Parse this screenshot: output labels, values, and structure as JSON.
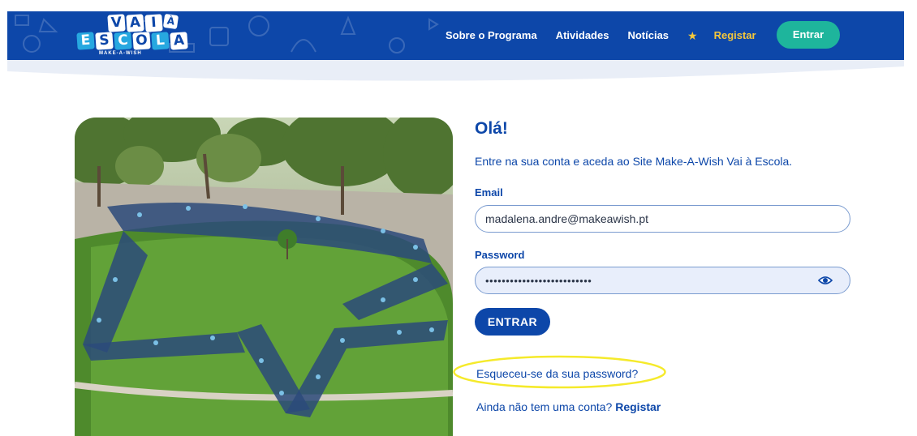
{
  "header": {
    "logo": {
      "line1": "VAI",
      "line1_sub": "À",
      "line2": "ESCOLA",
      "tagline": "MAKE-A-WISH"
    },
    "nav": {
      "about": "Sobre o Programa",
      "activities": "Atividades",
      "news": "Notícias",
      "star_icon": "star-icon",
      "register": "Registar",
      "login": "Entrar"
    },
    "colors": {
      "bar": "#0d47a9",
      "accent_yellow": "#f6c83a",
      "login_button": "#1eb59c"
    }
  },
  "hero_image": {
    "description_icon": "group-photo-star-formation"
  },
  "form": {
    "title": "Olá!",
    "intro": "Entre na sua conta e aceda ao Site Make-A-Wish Vai à Escola.",
    "email_label": "Email",
    "email_value": "madalena.andre@makeawish.pt",
    "password_label": "Password",
    "password_value": "••••••••••••••••••••••••••",
    "show_password_icon": "eye-icon",
    "submit_label": "ENTRAR",
    "forgot_link": "Esqueceu-se da sua password?",
    "signup_prompt": "Ainda não tem uma conta?",
    "signup_link": "Registar",
    "colors": {
      "primary": "#0d47a9",
      "highlight_ring": "#f5ea2b",
      "password_field_bg": "#e8eefb"
    }
  }
}
